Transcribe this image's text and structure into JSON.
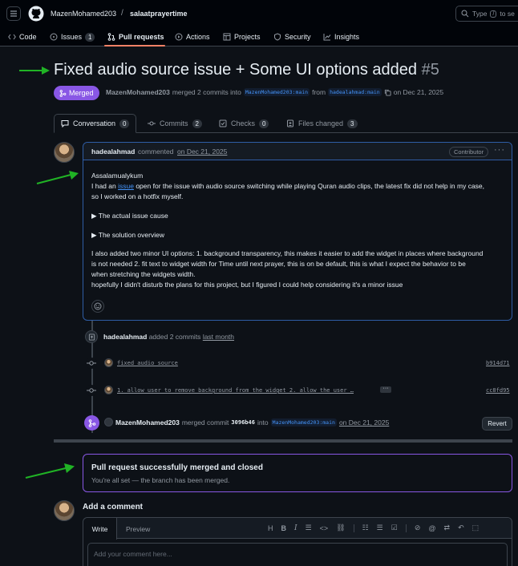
{
  "header": {
    "owner": "MazenMohamed203",
    "separator": "/",
    "repo": "salaatprayertime",
    "search_placeholder_prefix": "Type",
    "search_key": "/",
    "search_placeholder_suffix": "to se"
  },
  "repo_nav": {
    "code": "Code",
    "issues": "Issues",
    "issues_count": "1",
    "pull_requests": "Pull requests",
    "actions": "Actions",
    "projects": "Projects",
    "security": "Security",
    "insights": "Insights"
  },
  "pr": {
    "title": "Fixed audio source issue + Some UI options added",
    "number": "#5",
    "state": "Merged",
    "author": "MazenMohamed203",
    "merged_text": "merged 2 commits into",
    "base_ref": "MazenMohamed203:main",
    "from_text": "from",
    "head_ref": "hadealahmad:main",
    "on_text": "on Dec 21, 2025"
  },
  "pr_tabs": {
    "conversation": "Conversation",
    "conversation_count": "0",
    "commits": "Commits",
    "commits_count": "2",
    "checks": "Checks",
    "checks_count": "0",
    "files": "Files changed",
    "files_count": "3"
  },
  "comment": {
    "author": "hadealahmad",
    "action": "commented",
    "date": "on Dec 21, 2025",
    "role": "Contributor",
    "greeting": "Assalamualykum",
    "p1_pre": "I had an",
    "p1_link": "issue",
    "p1_post": "open for the issue with audio source switching while playing Quran audio clips, the latest fix did not help in my case,",
    "p1_line2": "so I worked on a hotfix myself.",
    "details1": "The actual issue cause",
    "details2": "The solution overview",
    "p2_line1": "I also added two minor UI options: 1. background transparency, this makes it easier to add the widget in places where background",
    "p2_line2": "is not needed 2. fit text to widget width for Time until next prayer, this is on be default, this is what I expect the behavior to be",
    "p2_line3": "when stretching the widgets width.",
    "p3": "hopefully I didn't disturb the plans for this project, but I figured I could help considering it's a minor issue"
  },
  "timeline": {
    "added_author": "hadealahmad",
    "added_text": "added 2 commits",
    "added_when": "last month",
    "commit1_msg": "fixed audio source",
    "commit1_sha": "b914d71",
    "commit2_msg": "1. allow user to remove background from the widget 2. allow the user …",
    "commit2_sha": "cc8fd95",
    "merge_author": "MazenMohamed203",
    "merge_text": "merged commit",
    "merge_sha": "3096b46",
    "merge_into": "into",
    "merge_base": "MazenMohamed203:main",
    "merge_date": "on Dec 21, 2025",
    "revert_label": "Revert"
  },
  "merged_box": {
    "title": "Pull request successfully merged and closed",
    "subtitle": "You're all set — the branch has been merged."
  },
  "add_comment": {
    "heading": "Add a comment",
    "write_tab": "Write",
    "preview_tab": "Preview",
    "placeholder": "Add your comment here..."
  },
  "colors": {
    "merged_purple": "#8957e5",
    "link_blue": "#4493f8",
    "annotation_arrow": "#20b325"
  }
}
